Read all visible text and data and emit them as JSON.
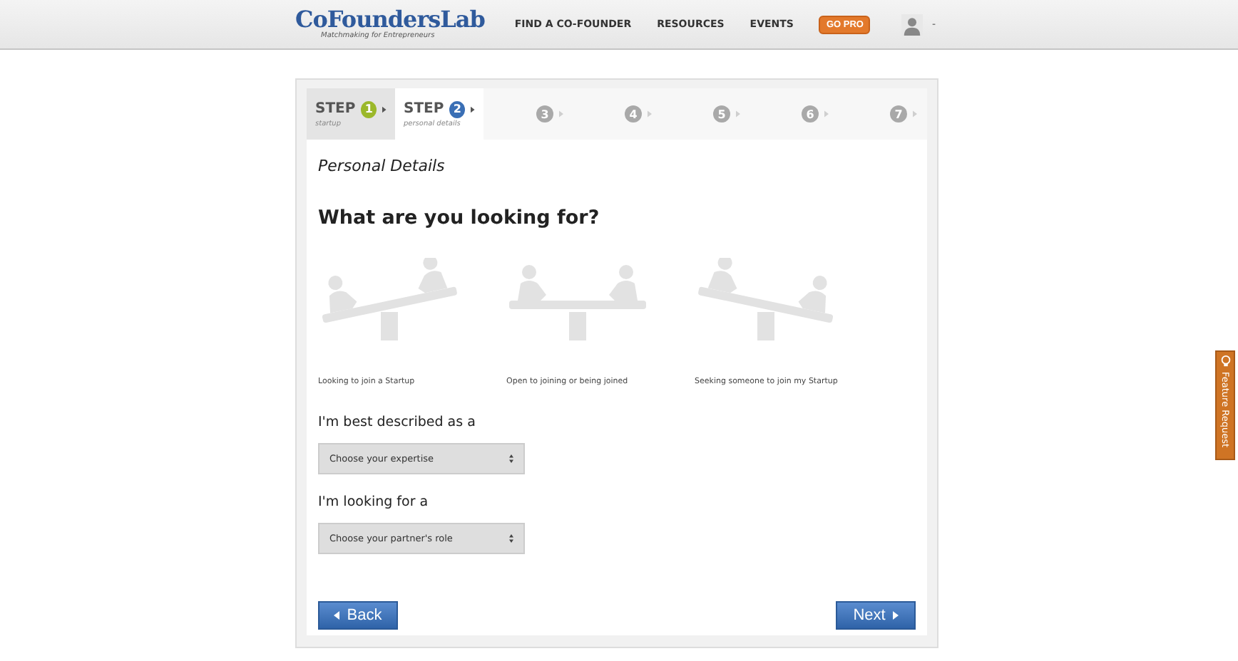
{
  "header": {
    "logo": "CoFoundersLab",
    "tagline": "Matchmaking for Entrepreneurs",
    "nav": [
      "FIND A CO-FOUNDER",
      "RESOURCES",
      "EVENTS"
    ],
    "pro_button": "GO PRO",
    "menu_caret": "-"
  },
  "steps": [
    {
      "word": "STEP",
      "number": "1",
      "caption": "startup",
      "done": true,
      "selected": false
    },
    {
      "word": "STEP",
      "number": "2",
      "caption": "personal details",
      "done": false,
      "selected": true
    },
    {
      "number": "3",
      "done": false,
      "selected": false
    },
    {
      "number": "4",
      "done": false,
      "selected": false
    },
    {
      "number": "5",
      "done": false,
      "selected": false
    },
    {
      "number": "6",
      "done": false,
      "selected": false
    },
    {
      "number": "7",
      "done": false,
      "selected": false
    }
  ],
  "section_title": "Personal Details",
  "question": "What are you looking for?",
  "options": [
    {
      "label": "Looking to join a Startup",
      "selected": false
    },
    {
      "label": "Open to joining or being joined",
      "selected": false
    },
    {
      "label": "Seeking someone to join my Startup",
      "selected": false
    }
  ],
  "fields": [
    {
      "label": "I'm best described as a",
      "placeholder": "Choose your expertise"
    },
    {
      "label": "I'm looking for a",
      "placeholder": "Choose your partner's role"
    }
  ],
  "back_button": "Back",
  "next_button": "Next",
  "feature_tab": "Feature Request"
}
